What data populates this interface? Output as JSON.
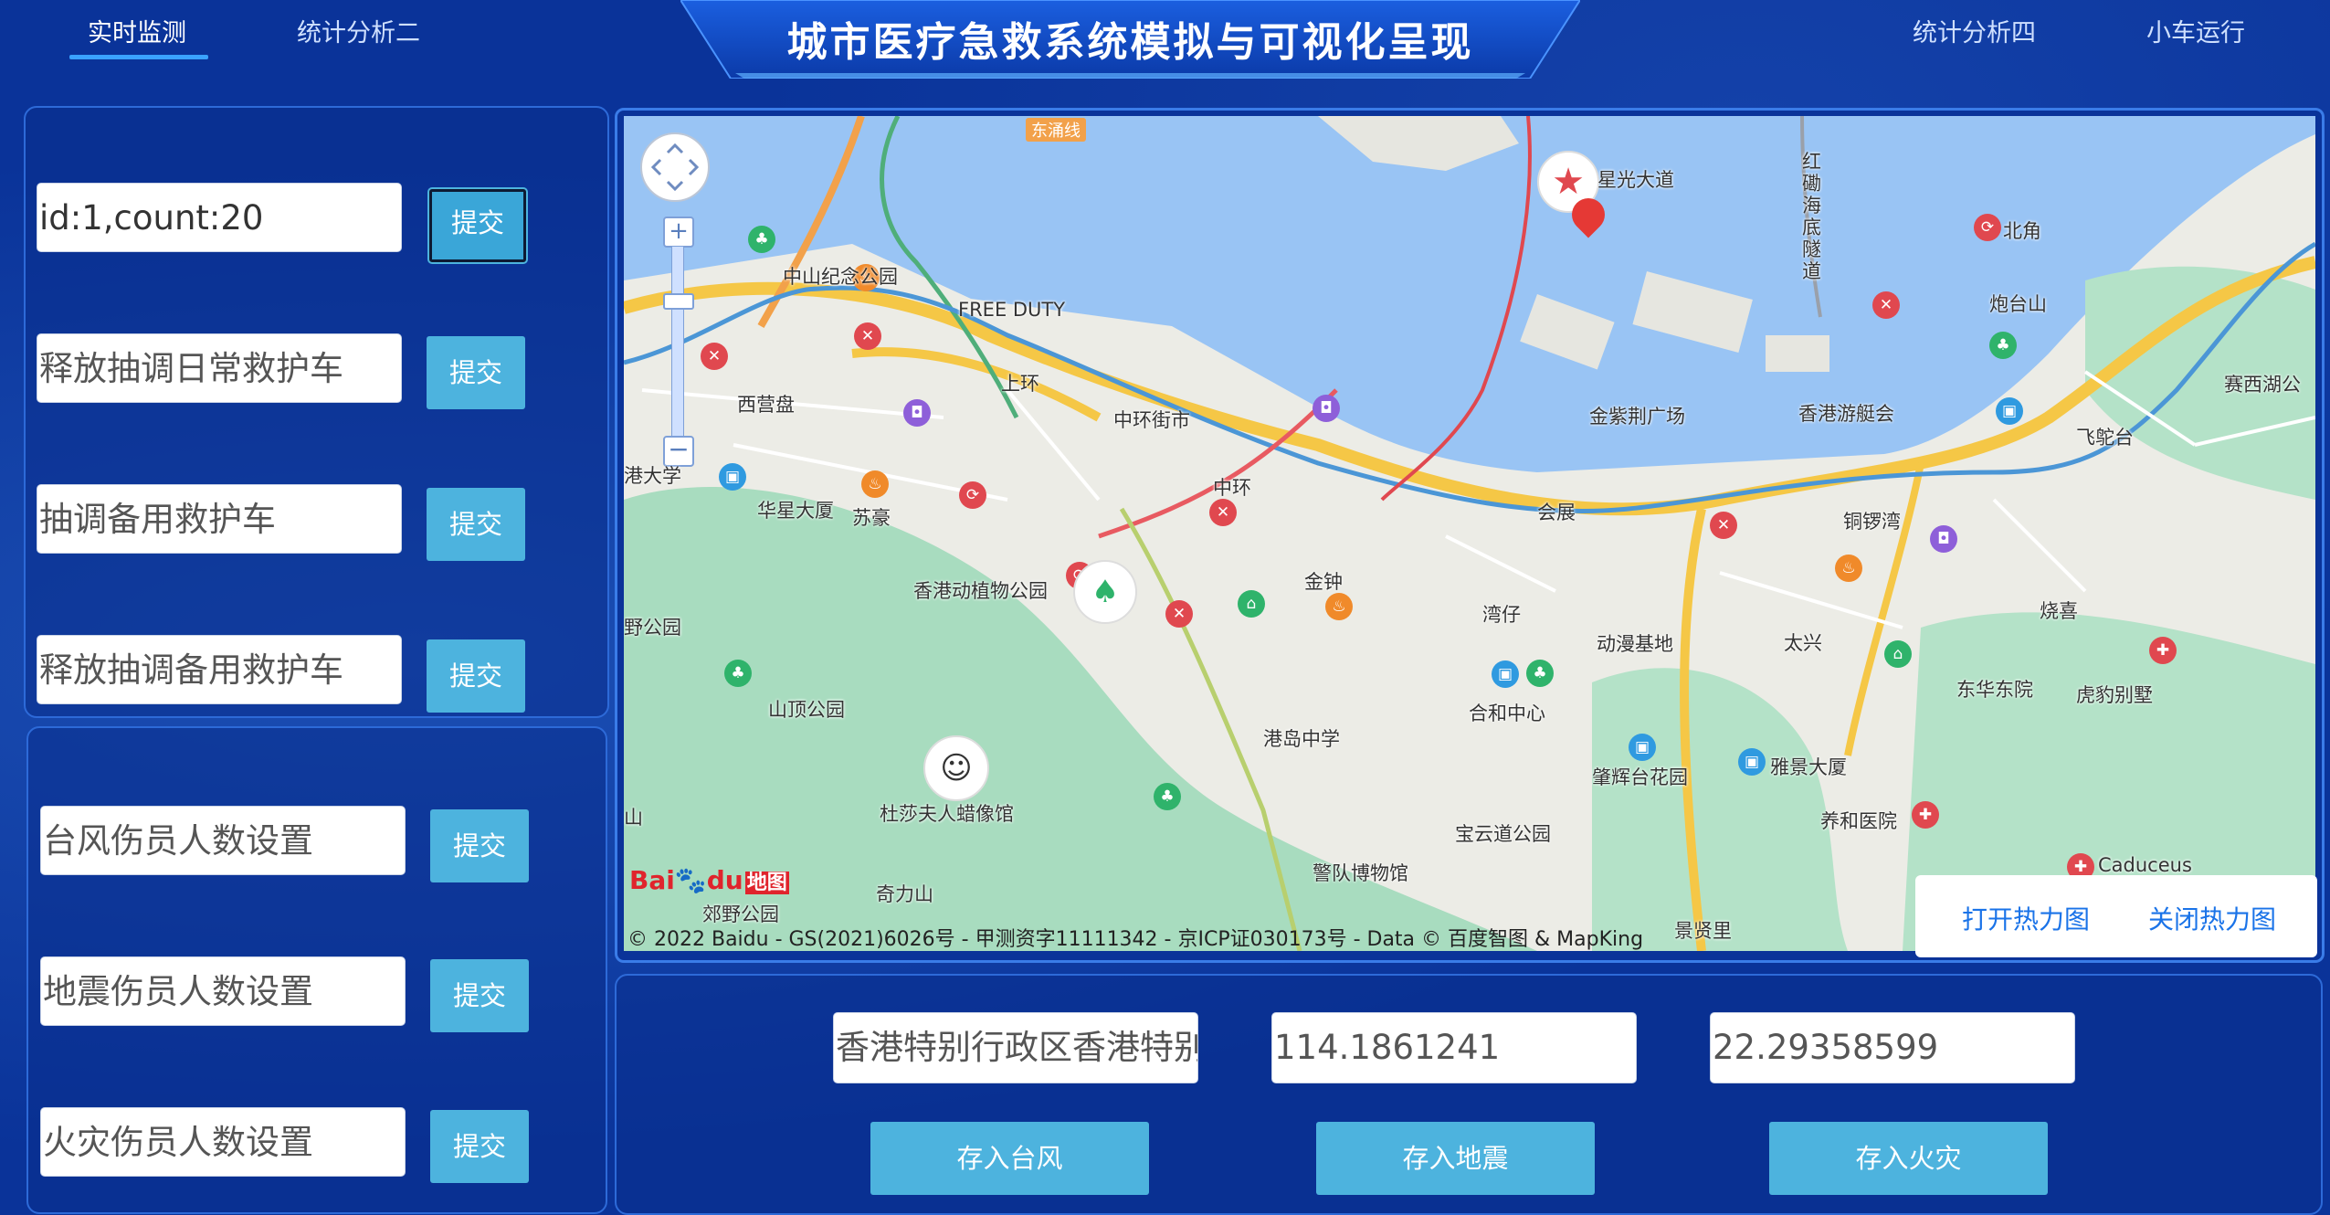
{
  "nav": {
    "tab_realtime": "实时监测",
    "tab_stats2": "统计分析二",
    "tab_stats4": "统计分析四",
    "tab_car": "小车运行"
  },
  "title": "城市医疗急救系统模拟与可视化呈现",
  "left_top_panel": {
    "rows": [
      {
        "value": "id:1,count:20",
        "button": "提交"
      },
      {
        "placeholder": "释放抽调日常救护车",
        "button": "提交"
      },
      {
        "placeholder": "抽调备用救护车",
        "button": "提交"
      },
      {
        "placeholder": "释放抽调备用救护车",
        "button": "提交"
      }
    ]
  },
  "left_bottom_panel": {
    "rows": [
      {
        "placeholder": "台风伤员人数设置",
        "button": "提交"
      },
      {
        "placeholder": "地震伤员人数设置",
        "button": "提交"
      },
      {
        "placeholder": "火灾伤员人数设置",
        "button": "提交"
      }
    ]
  },
  "map": {
    "copyright": "© 2022 Baidu - GS(2021)6026号 - 甲测资字11111342 - 京ICP证030173号 - Data © 百度智图 & MapKing",
    "logo_text": "Baidu地图",
    "heatmap_open": "打开热力图",
    "heatmap_close": "关闭热力图",
    "labels": [
      "星光大道",
      "东涌线",
      "红磡海底隧道",
      "中山纪念公园",
      "FREE DUTY",
      "西营盘",
      "上环",
      "中环街市",
      "金紫荆广场",
      "香港游艇会",
      "北角",
      "炮台山",
      "赛西湖公",
      "飞鸵台",
      "港大学",
      "华星大厦",
      "苏豪",
      "中环",
      "会展",
      "铜锣湾",
      "香港动植物公园",
      "金钟",
      "湾仔",
      "动漫基地",
      "太兴",
      "烧喜",
      "野公园",
      "山顶公园",
      "港岛中学",
      "合和中心",
      "东华东院",
      "虎豹别墅",
      "肇辉台花园",
      "雅景大厦",
      "杜莎夫人蜡像馆",
      "宝云道公园",
      "养和医院",
      "山",
      "奇力山",
      "警队博物馆",
      "景贤里",
      "Caduceus",
      "郊野公园"
    ]
  },
  "bottom_form": {
    "address": "香港特别行政区香港特别行政区",
    "longitude": "114.1861241",
    "latitude": "22.29358599",
    "save_typhoon": "存入台风",
    "save_earthquake": "存入地震",
    "save_fire": "存入火灾"
  }
}
